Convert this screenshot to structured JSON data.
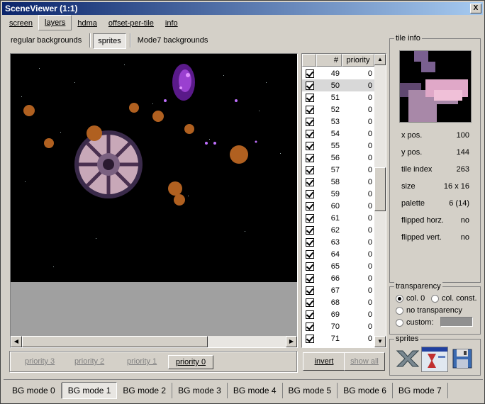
{
  "title": "SceneViewer (1:1)",
  "close_label": "X",
  "tabs": [
    "screen",
    "layers",
    "hdma",
    "offset-per-tile",
    "info"
  ],
  "subtabs": [
    "regular backgrounds",
    "sprites",
    "Mode7 backgrounds"
  ],
  "list": {
    "col_num": "#",
    "col_priority": "priority",
    "rows": [
      {
        "n": "49",
        "p": "0"
      },
      {
        "n": "50",
        "p": "0"
      },
      {
        "n": "51",
        "p": "0"
      },
      {
        "n": "52",
        "p": "0"
      },
      {
        "n": "53",
        "p": "0"
      },
      {
        "n": "54",
        "p": "0"
      },
      {
        "n": "55",
        "p": "0"
      },
      {
        "n": "56",
        "p": "0"
      },
      {
        "n": "57",
        "p": "0"
      },
      {
        "n": "58",
        "p": "0"
      },
      {
        "n": "59",
        "p": "0"
      },
      {
        "n": "60",
        "p": "0"
      },
      {
        "n": "61",
        "p": "0"
      },
      {
        "n": "62",
        "p": "0"
      },
      {
        "n": "63",
        "p": "0"
      },
      {
        "n": "64",
        "p": "0"
      },
      {
        "n": "65",
        "p": "0"
      },
      {
        "n": "66",
        "p": "0"
      },
      {
        "n": "67",
        "p": "0"
      },
      {
        "n": "68",
        "p": "0"
      },
      {
        "n": "69",
        "p": "0"
      },
      {
        "n": "70",
        "p": "0"
      },
      {
        "n": "71",
        "p": "0"
      }
    ]
  },
  "priority_buttons": [
    "priority 3",
    "priority 2",
    "priority 1",
    "priority 0"
  ],
  "invert_label": "invert",
  "show_all_label": "show all",
  "tile_info": {
    "legend": "tile info",
    "rows": [
      {
        "label": "x pos.",
        "value": "100"
      },
      {
        "label": "y pos.",
        "value": "144"
      },
      {
        "label": "tile index",
        "value": "263"
      },
      {
        "label": "size",
        "value": "16 x 16"
      },
      {
        "label": "palette",
        "value": "6 (14)"
      },
      {
        "label": "flipped horz.",
        "value": "no"
      },
      {
        "label": "flipped vert.",
        "value": "no"
      }
    ]
  },
  "transparency": {
    "legend": "transparency",
    "col0": "col. 0",
    "col_const": "col. const.",
    "none": "no transparency",
    "custom": "custom:"
  },
  "sprites_legend": "sprites",
  "bg_modes": [
    "BG mode 0",
    "BG mode 1",
    "BG mode 2",
    "BG mode 3",
    "BG mode 4",
    "BG mode 5",
    "BG mode 6",
    "BG mode 7"
  ]
}
